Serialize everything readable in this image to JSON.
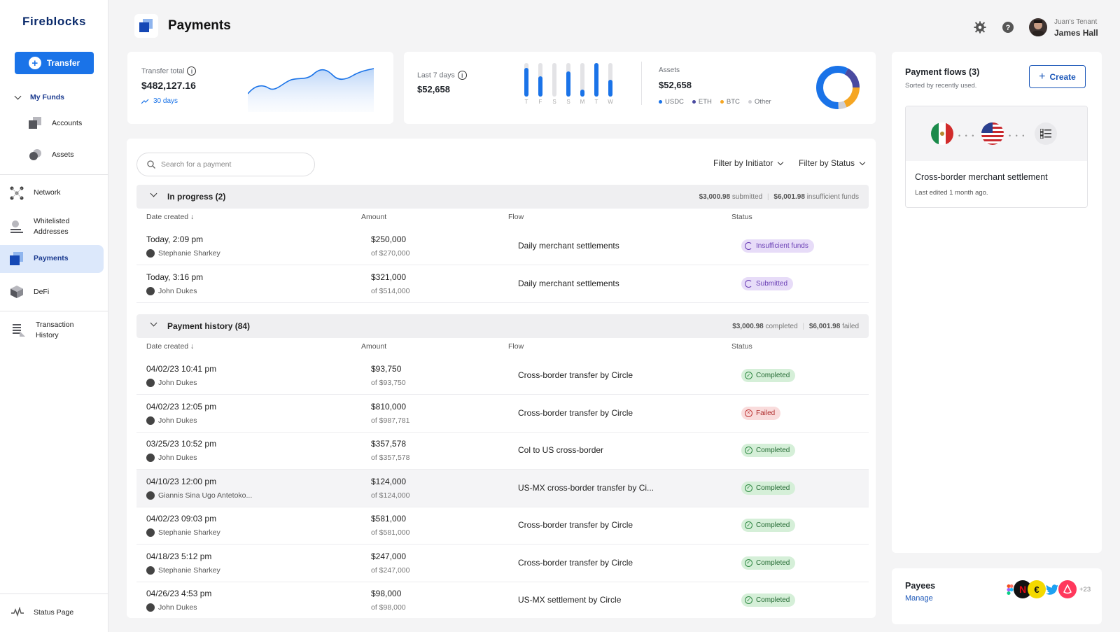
{
  "app": {
    "name": "Fireblocks",
    "page_title": "Payments"
  },
  "sidebar": {
    "transfer_label": "Transfer",
    "my_funds": "My Funds",
    "items": [
      {
        "label": "Accounts"
      },
      {
        "label": "Assets"
      },
      {
        "label": "Network"
      },
      {
        "label": "Whitelisted Addresses"
      },
      {
        "label": "Payments"
      },
      {
        "label": "DeFi"
      },
      {
        "label": "Transaction History"
      },
      {
        "label": "Status Page"
      }
    ]
  },
  "header": {
    "tenant": "Juan's Tenant",
    "user": "James Hall"
  },
  "stats": {
    "transfer_total_label": "Transfer total",
    "transfer_total_value": "$482,127.16",
    "transfer_period": "30 days",
    "last7_label": "Last 7 days",
    "last7_value": "$52,658",
    "weekdays": [
      "T",
      "F",
      "S",
      "S",
      "M",
      "T",
      "W"
    ],
    "weekday_levels": [
      0.85,
      0.6,
      0.0,
      0.75,
      0.2,
      1.0,
      0.5
    ],
    "assets_label": "Assets",
    "assets_value": "$52,658",
    "asset_legend": [
      {
        "name": "USDC",
        "color": "#1a73e8"
      },
      {
        "name": "ETH",
        "color": "#4a4aa0"
      },
      {
        "name": "BTC",
        "color": "#f5a623"
      },
      {
        "name": "Other",
        "color": "#cfcfd4"
      }
    ]
  },
  "table": {
    "search_placeholder": "Search for a payment",
    "filter_initiator": "Filter by Initiator",
    "filter_status": "Filter by Status",
    "columns": {
      "date": "Date created",
      "amount": "Amount",
      "flow": "Flow",
      "status": "Status"
    },
    "in_progress": {
      "title": "In progress (2)",
      "sum_submitted_value": "$3,000.98",
      "sum_submitted_label": "submitted",
      "sum_insufficient_value": "$6,001.98",
      "sum_insufficient_label": "insufficient funds",
      "rows": [
        {
          "date": "Today, 2:09 pm",
          "initiator": "Stephanie Sharkey",
          "amount": "$250,000",
          "of": "of $270,000",
          "flow": "Daily merchant settlements",
          "status": "Insufficient funds"
        },
        {
          "date": "Today, 3:16 pm",
          "initiator": "John Dukes",
          "amount": "$321,000",
          "of": "of $514,000",
          "flow": "Daily merchant settlements",
          "status": "Submitted"
        }
      ]
    },
    "history": {
      "title": "Payment history (84)",
      "sum_completed_value": "$3,000.98",
      "sum_completed_label": "completed",
      "sum_failed_value": "$6,001.98",
      "sum_failed_label": "failed",
      "rows": [
        {
          "date": "04/02/23 10:41 pm",
          "initiator": "John Dukes",
          "amount": "$93,750",
          "of": "of $93,750",
          "flow": "Cross-border transfer by Circle",
          "status": "Completed"
        },
        {
          "date": "04/02/23 12:05 pm",
          "initiator": "John Dukes",
          "amount": "$810,000",
          "of": "of $987,781",
          "flow": "Cross-border transfer by Circle",
          "status": "Failed"
        },
        {
          "date": "03/25/23 10:52 pm",
          "initiator": "John Dukes",
          "amount": "$357,578",
          "of": "of $357,578",
          "flow": "Col to US cross-border",
          "status": "Completed"
        },
        {
          "date": "04/10/23 12:00 pm",
          "initiator": "Giannis Sina Ugo Antetoko...",
          "amount": "$124,000",
          "of": "of $124,000",
          "flow": "US-MX cross-border transfer by Ci...",
          "status": "Completed"
        },
        {
          "date": "04/02/23 09:03 pm",
          "initiator": "Stephanie Sharkey",
          "amount": "$581,000",
          "of": "of $581,000",
          "flow": "Cross-border transfer by Circle",
          "status": "Completed"
        },
        {
          "date": "04/18/23 5:12 pm",
          "initiator": "Stephanie Sharkey",
          "amount": "$247,000",
          "of": "of $247,000",
          "flow": "Cross-border transfer by Circle",
          "status": "Completed"
        },
        {
          "date": "04/26/23 4:53 pm",
          "initiator": "John Dukes",
          "amount": "$98,000",
          "of": "of $98,000",
          "flow": "US-MX settlement by Circle",
          "status": "Completed"
        }
      ]
    }
  },
  "flows": {
    "title": "Payment flows (3)",
    "subtitle": "Sorted by recently used.",
    "create_label": "Create",
    "card_title": "Cross-border merchant settlement",
    "card_subtitle": "Last edited 1 month ago."
  },
  "payees": {
    "title": "Payees",
    "manage": "Manage",
    "more": "+23"
  }
}
